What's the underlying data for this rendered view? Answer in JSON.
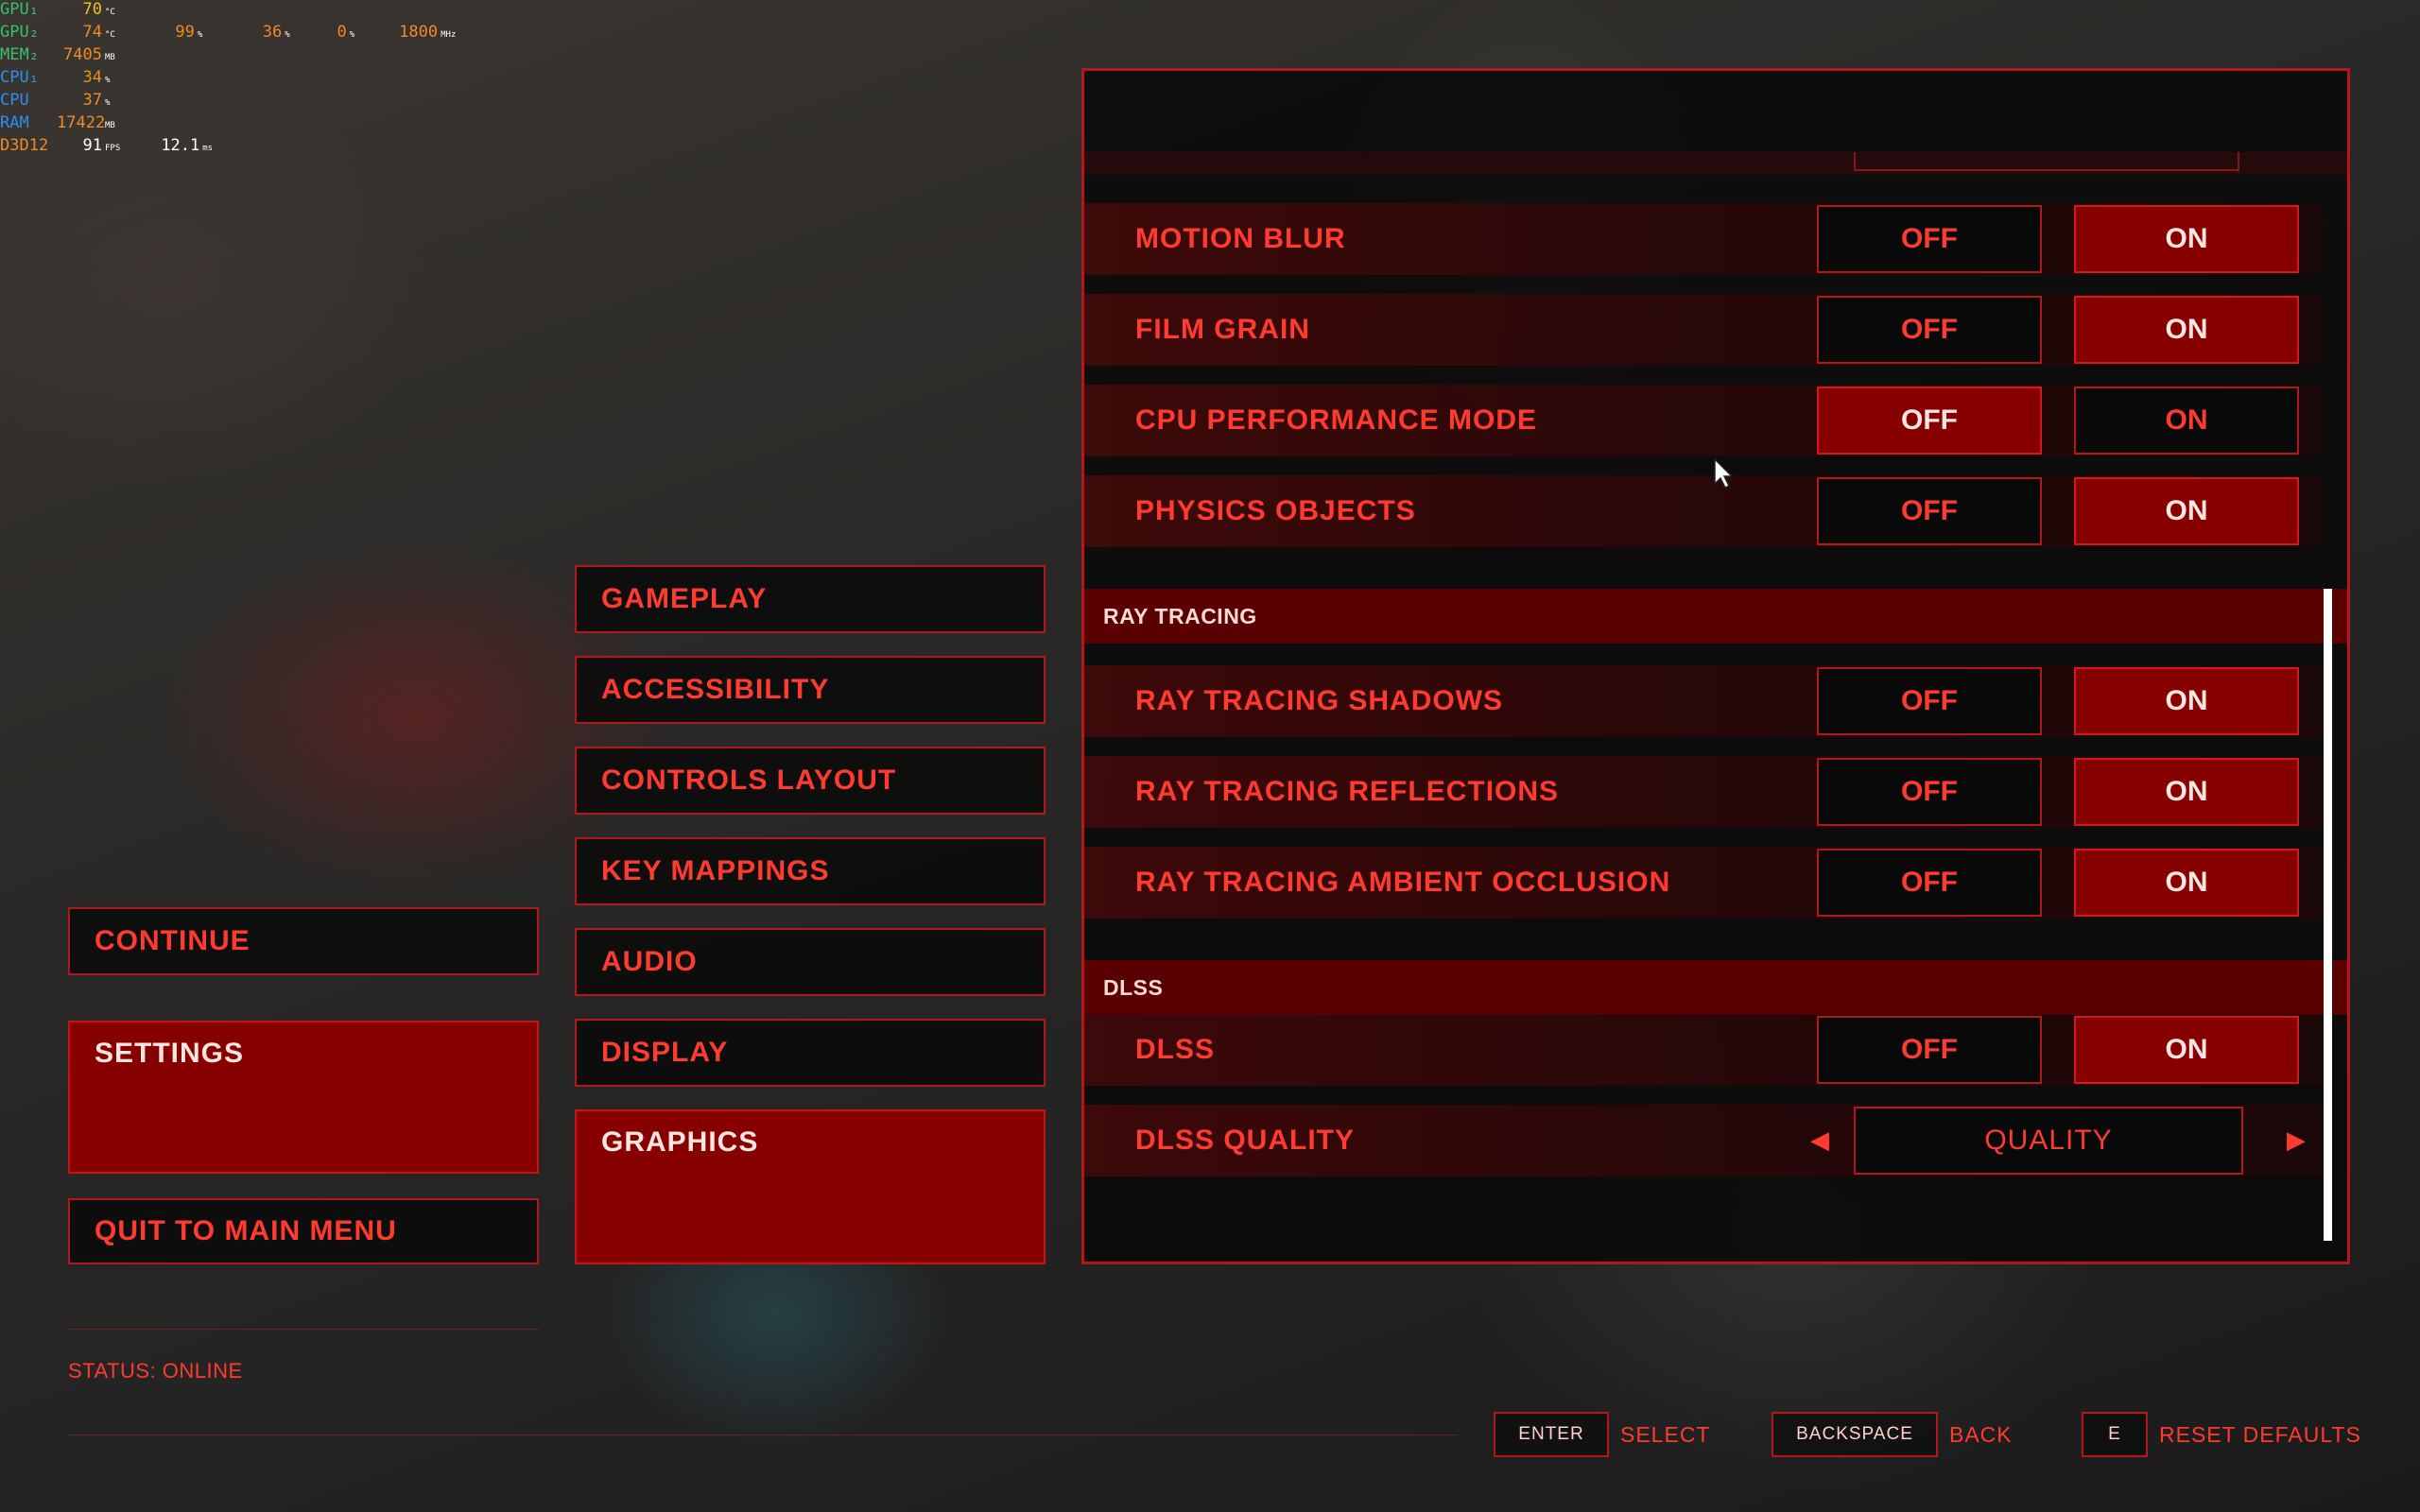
{
  "overlay": {
    "rows": [
      {
        "label": "GPU₁",
        "label_color": "green",
        "values": [
          {
            "v": "70",
            "u": "°C",
            "c": "yellow"
          }
        ]
      },
      {
        "label": "GPU₂",
        "label_color": "green",
        "values": [
          {
            "v": "74",
            "u": "°C",
            "c": "orange"
          },
          {
            "v": "99",
            "u": "%",
            "c": "orange"
          },
          {
            "v": "36",
            "u": "%",
            "c": "orange"
          },
          {
            "v": "0",
            "u": "%",
            "c": "orange"
          },
          {
            "v": "1800",
            "u": "MHz",
            "c": "orange"
          }
        ]
      },
      {
        "label": "MEM₂",
        "label_color": "green",
        "values": [
          {
            "v": "7405",
            "u": "MB",
            "c": "orange"
          }
        ]
      },
      {
        "label": "CPU₁",
        "label_color": "blue",
        "values": [
          {
            "v": "34",
            "u": "%",
            "c": "orange"
          }
        ]
      },
      {
        "label": "CPU",
        "label_color": "blue",
        "values": [
          {
            "v": "37",
            "u": "%",
            "c": "orange"
          }
        ]
      },
      {
        "label": "RAM",
        "label_color": "blue",
        "values": [
          {
            "v": "17422",
            "u": "MB",
            "c": "orange"
          }
        ]
      },
      {
        "label": "D3D12",
        "label_color": "orange",
        "values": [
          {
            "v": "91",
            "u": "FPS",
            "c": "white"
          },
          {
            "v": "12.1",
            "u": "ms",
            "c": "white"
          }
        ]
      }
    ]
  },
  "main_menu": {
    "continue": "CONTINUE",
    "settings": "SETTINGS",
    "quit": "QUIT TO MAIN MENU"
  },
  "settings_tabs": {
    "gameplay": "GAMEPLAY",
    "accessibility": "ACCESSIBILITY",
    "controls_layout": "CONTROLS LAYOUT",
    "key_mappings": "KEY MAPPINGS",
    "audio": "AUDIO",
    "display": "DISPLAY",
    "graphics": "GRAPHICS"
  },
  "graphics": {
    "off_label": "OFF",
    "on_label": "ON",
    "motion_blur": {
      "label": "MOTION BLUR",
      "value": "ON"
    },
    "film_grain": {
      "label": "FILM GRAIN",
      "value": "ON"
    },
    "cpu_performance_mode": {
      "label": "CPU PERFORMANCE MODE",
      "value": "OFF"
    },
    "physics_objects": {
      "label": "PHYSICS OBJECTS",
      "value": "ON"
    },
    "ray_tracing_section": "RAY TRACING",
    "rt_shadows": {
      "label": "RAY TRACING SHADOWS",
      "value": "ON"
    },
    "rt_reflections": {
      "label": "RAY TRACING REFLECTIONS",
      "value": "ON"
    },
    "rt_ambient_occlusion": {
      "label": "RAY TRACING AMBIENT OCCLUSION",
      "value": "ON"
    },
    "dlss_section": "DLSS",
    "dlss": {
      "label": "DLSS",
      "value": "ON"
    },
    "dlss_quality": {
      "label": "DLSS QUALITY",
      "value": "QUALITY"
    }
  },
  "status": "STATUS: ONLINE",
  "footer": {
    "enter_key": "ENTER",
    "enter_action": "SELECT",
    "backspace_key": "BACKSPACE",
    "backspace_action": "BACK",
    "e_key": "E",
    "e_action": "RESET DEFAULTS"
  },
  "colors": {
    "accent_red": "#ff3b30",
    "selected_fill": "#870000",
    "border_red": "#b3171b",
    "section_header": "#5a0000"
  }
}
